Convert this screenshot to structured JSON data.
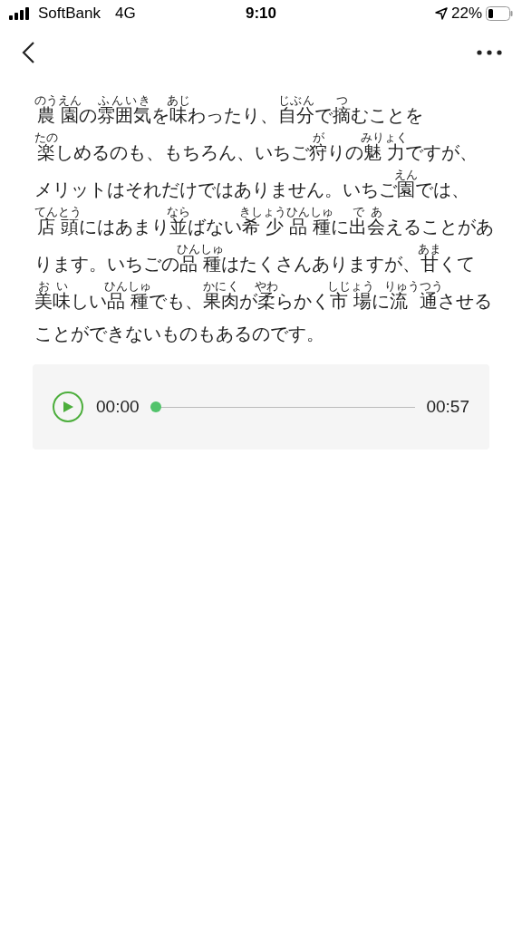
{
  "status_bar": {
    "carrier": "SoftBank",
    "network": "4G",
    "time": "9:10",
    "battery": "22%"
  },
  "article": {
    "lines": [
      [
        {
          "text": "農園",
          "ruby": "のうえん"
        },
        {
          "text": "の"
        },
        {
          "text": "雰囲気",
          "ruby": "ふんいき"
        },
        {
          "text": "を"
        },
        {
          "text": "味",
          "ruby": "あじ"
        },
        {
          "text": "わったり、"
        },
        {
          "text": "自分",
          "ruby": "じぶん"
        },
        {
          "text": "で"
        },
        {
          "text": "摘",
          "ruby": "つ"
        },
        {
          "text": "むことを"
        }
      ],
      [
        {
          "text": "楽",
          "ruby": "たの"
        },
        {
          "text": "しめるのも、もちろん、いちご"
        },
        {
          "text": "狩",
          "ruby": "が"
        },
        {
          "text": "りの"
        },
        {
          "text": "魅力",
          "ruby": "みりょく"
        },
        {
          "text": "ですが、"
        }
      ],
      [
        {
          "text": "メリットはそれだけではありません。いちご"
        },
        {
          "text": "園",
          "ruby": "えん"
        },
        {
          "text": "では、"
        }
      ],
      [
        {
          "text": "店頭",
          "ruby": "てんとう"
        },
        {
          "text": "にはあまり"
        },
        {
          "text": "並",
          "ruby": "なら"
        },
        {
          "text": "ばない"
        },
        {
          "text": "希少品種",
          "ruby": "きしょうひんしゅ"
        },
        {
          "text": "に"
        },
        {
          "text": "出会",
          "ruby": "であ"
        },
        {
          "text": "えることがあ"
        }
      ],
      [
        {
          "text": "ります。いちごの"
        },
        {
          "text": "品種",
          "ruby": "ひんしゅ"
        },
        {
          "text": "はたくさんありますが、"
        },
        {
          "text": "甘",
          "ruby": "あま"
        },
        {
          "text": "くて"
        }
      ],
      [
        {
          "text": "美味",
          "ruby": "おい"
        },
        {
          "text": "しい"
        },
        {
          "text": "品種",
          "ruby": "ひんしゅ"
        },
        {
          "text": "でも、"
        },
        {
          "text": "果肉",
          "ruby": "かにく"
        },
        {
          "text": "が"
        },
        {
          "text": "柔",
          "ruby": "やわ"
        },
        {
          "text": "らかく"
        },
        {
          "text": "市場",
          "ruby": "しじょう"
        },
        {
          "text": "に"
        },
        {
          "text": "流通",
          "ruby": "りゅうつう"
        },
        {
          "text": "させる"
        }
      ],
      [
        {
          "text": "ことができないものもあるのです。"
        }
      ]
    ]
  },
  "audio_player": {
    "current_time": "00:00",
    "duration": "00:57",
    "level": 0
  }
}
